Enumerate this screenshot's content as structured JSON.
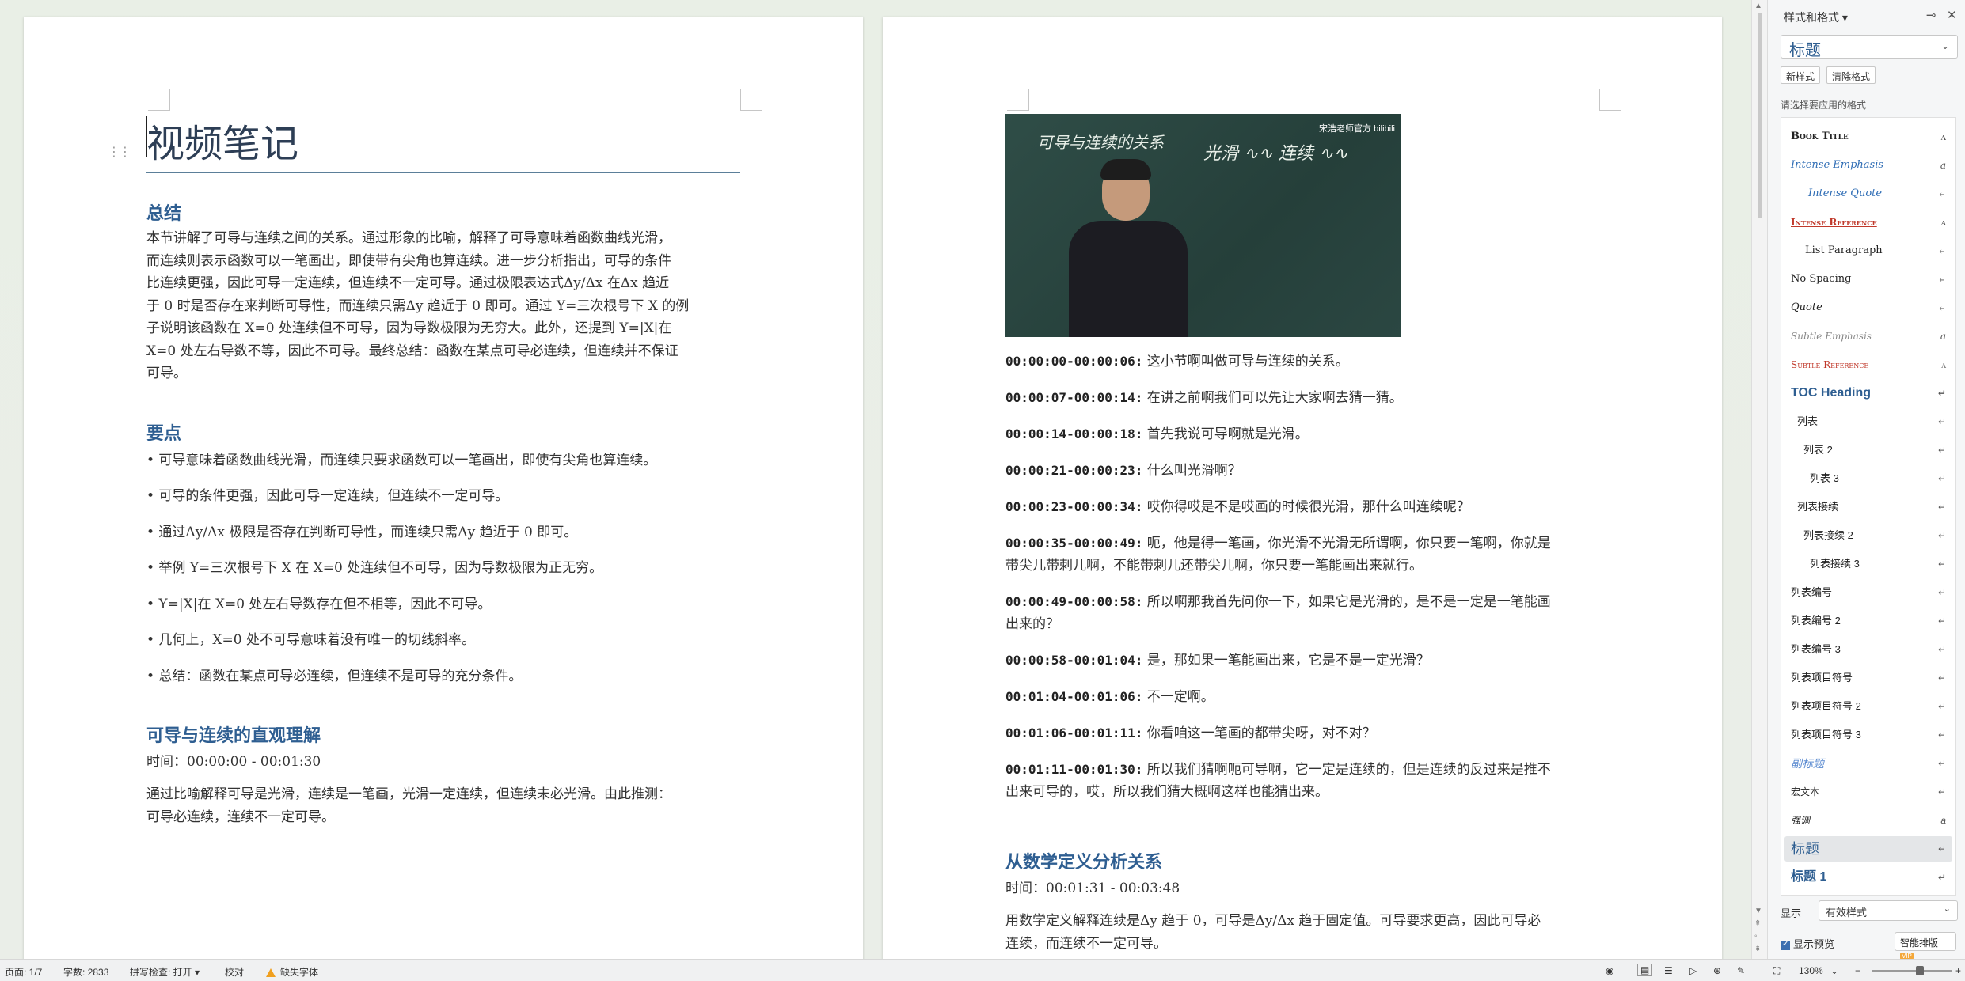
{
  "page1": {
    "title": "视频笔记",
    "summary_heading": "总结",
    "summary_lines": [
      "本节讲解了可导与连续之间的关系。通过形象的比喻，解释了可导意味着函数曲线光滑，",
      "而连续则表示函数可以一笔画出，即使带有尖角也算连续。进一步分析指出，可导的条件",
      "比连续更强，因此可导一定连续，但连续不一定可导。通过极限表达式Δy/Δx 在Δx 趋近",
      "于 0 时是否存在来判断可导性，而连续只需Δy 趋近于 0 即可。通过 Y=三次根号下 X 的例",
      "子说明该函数在 X=0 处连续但不可导，因为导数极限为无穷大。此外，还提到 Y=|X|在",
      "X=0 处左右导数不等，因此不可导。最终总结：函数在某点可导必连续，但连续并不保证",
      "可导。"
    ],
    "keypoints_heading": "要点",
    "keypoints": [
      "• 可导意味着函数曲线光滑，而连续只要求函数可以一笔画出，即使有尖角也算连续。",
      "• 可导的条件更强，因此可导一定连续，但连续不一定可导。",
      "• 通过Δy/Δx 极限是否存在判断可导性，而连续只需Δy 趋近于 0 即可。",
      "• 举例 Y=三次根号下 X 在 X=0 处连续但不可导，因为导数极限为正无穷。",
      "• Y=|X|在 X=0 处左右导数存在但不相等，因此不可导。",
      "• 几何上，X=0 处不可导意味着没有唯一的切线斜率。",
      "• 总结：函数在某点可导必连续，但连续不是可导的充分条件。"
    ],
    "section1_heading": "可导与连续的直观理解",
    "section1_time": "时间：00:00:00 - 00:01:30",
    "section1_lines": [
      "通过比喻解释可导是光滑，连续是一笔画，光滑一定连续，但连续未必光滑。由此推测：",
      "可导必连续，连续不一定可导。"
    ]
  },
  "page2": {
    "video_board_text": "可导与连续的关系",
    "video_board_text2": "光滑 ∿∿  连续 ∿∿",
    "video_logo": "宋浩老师官方 bilibili",
    "transcript": [
      {
        "ts": "00:00:00-00:00:06:",
        "text": " 这小节啊叫做可导与连续的关系。"
      },
      {
        "ts": "00:00:07-00:00:14:",
        "text": " 在讲之前啊我们可以先让大家啊去猜一猜。"
      },
      {
        "ts": "00:00:14-00:00:18:",
        "text": " 首先我说可导啊就是光滑。"
      },
      {
        "ts": "00:00:21-00:00:23:",
        "text": " 什么叫光滑啊？"
      },
      {
        "ts": "00:00:23-00:00:34:",
        "text": " 哎你得哎是不是哎画的时候很光滑，那什么叫连续呢？"
      },
      {
        "ts": "00:00:35-00:00:49:",
        "text": " 呃，他是得一笔画，你光滑不光滑无所谓啊，你只要一笔啊，你就是",
        "text2": "带尖儿带刺儿啊，不能带刺儿还带尖儿啊，你只要一笔能画出来就行。"
      },
      {
        "ts": "00:00:49-00:00:58:",
        "text": " 所以啊那我首先问你一下，如果它是光滑的，是不是一定是一笔能画",
        "text2": "出来的？"
      },
      {
        "ts": "00:00:58-00:01:04:",
        "text": " 是，那如果一笔能画出来，它是不是一定光滑？"
      },
      {
        "ts": "00:01:04-00:01:06:",
        "text": " 不一定啊。"
      },
      {
        "ts": "00:01:06-00:01:11:",
        "text": " 你看咱这一笔画的都带尖呀，对不对？"
      },
      {
        "ts": "00:01:11-00:01:30:",
        "text": " 所以我们猜啊呃可导啊，它一定是连续的，但是连续的反过来是推不",
        "text2": "出来可导的，哎，所以我们猜大概啊这样也能猜出来。"
      }
    ],
    "section2_heading": "从数学定义分析关系",
    "section2_time": "时间：00:01:31 - 00:03:48",
    "section2_lines": [
      "用数学定义解释连续是Δy 趋于 0，可导是Δy/Δx 趋于固定值。可导要求更高，因此可导必",
      "连续，而连续不一定可导。"
    ]
  },
  "panel": {
    "title": "样式和格式 ▾",
    "current_style": "标题",
    "new_style": "新样式",
    "clear_format": "清除格式",
    "apply_label": "请选择要应用的格式",
    "styles": [
      {
        "label": "Book Title",
        "mark": "a"
      },
      {
        "label": "Intense Emphasis",
        "mark": "a"
      },
      {
        "label": "Intense Quote",
        "mark": "↵"
      },
      {
        "label": "Intense Reference",
        "mark": "a"
      },
      {
        "label": "List Paragraph",
        "mark": "↵"
      },
      {
        "label": "No Spacing",
        "mark": "↵"
      },
      {
        "label": "Quote",
        "mark": "↵"
      },
      {
        "label": "Subtle Emphasis",
        "mark": "a"
      },
      {
        "label": "Subtle Reference",
        "mark": "a"
      },
      {
        "label": "TOC Heading",
        "mark": "↵"
      },
      {
        "label": "列表",
        "mark": "↵"
      },
      {
        "label": "列表 2",
        "mark": "↵"
      },
      {
        "label": "列表 3",
        "mark": "↵"
      },
      {
        "label": "列表接续",
        "mark": "↵"
      },
      {
        "label": "列表接续 2",
        "mark": "↵"
      },
      {
        "label": "列表接续 3",
        "mark": "↵"
      },
      {
        "label": "列表编号",
        "mark": "↵"
      },
      {
        "label": "列表编号 2",
        "mark": "↵"
      },
      {
        "label": "列表编号 3",
        "mark": "↵"
      },
      {
        "label": "列表项目符号",
        "mark": "↵"
      },
      {
        "label": "列表项目符号 2",
        "mark": "↵"
      },
      {
        "label": "列表项目符号 3",
        "mark": "↵"
      },
      {
        "label": "副标题",
        "mark": "↵"
      },
      {
        "label": "宏文本",
        "mark": "↵"
      },
      {
        "label": "强调",
        "mark": "a"
      },
      {
        "label": "标题",
        "mark": "↵"
      },
      {
        "label": "标题 1",
        "mark": "↵"
      }
    ],
    "show_label": "显示",
    "show_value": "有效样式",
    "preview_label": "显示预览",
    "smart_layout": "智能排版",
    "vip": "VIP"
  },
  "status": {
    "page": "页面: 1/7",
    "words": "字数: 2833",
    "spellcheck": "拼写检查: 打开 ▾",
    "proof": "校对",
    "missing_font": "缺失字体",
    "zoom": "130%"
  }
}
